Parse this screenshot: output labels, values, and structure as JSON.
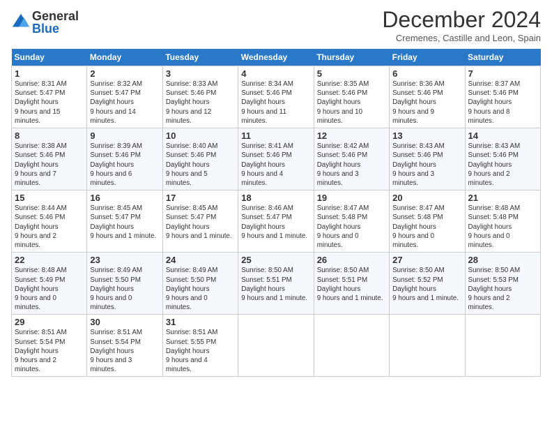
{
  "header": {
    "logo_general": "General",
    "logo_blue": "Blue",
    "month_title": "December 2024",
    "location": "Cremenes, Castille and Leon, Spain"
  },
  "days_of_week": [
    "Sunday",
    "Monday",
    "Tuesday",
    "Wednesday",
    "Thursday",
    "Friday",
    "Saturday"
  ],
  "weeks": [
    [
      {
        "num": "1",
        "sunrise": "8:31 AM",
        "sunset": "5:47 PM",
        "daylight": "9 hours and 15 minutes."
      },
      {
        "num": "2",
        "sunrise": "8:32 AM",
        "sunset": "5:47 PM",
        "daylight": "9 hours and 14 minutes."
      },
      {
        "num": "3",
        "sunrise": "8:33 AM",
        "sunset": "5:46 PM",
        "daylight": "9 hours and 12 minutes."
      },
      {
        "num": "4",
        "sunrise": "8:34 AM",
        "sunset": "5:46 PM",
        "daylight": "9 hours and 11 minutes."
      },
      {
        "num": "5",
        "sunrise": "8:35 AM",
        "sunset": "5:46 PM",
        "daylight": "9 hours and 10 minutes."
      },
      {
        "num": "6",
        "sunrise": "8:36 AM",
        "sunset": "5:46 PM",
        "daylight": "9 hours and 9 minutes."
      },
      {
        "num": "7",
        "sunrise": "8:37 AM",
        "sunset": "5:46 PM",
        "daylight": "9 hours and 8 minutes."
      }
    ],
    [
      {
        "num": "8",
        "sunrise": "8:38 AM",
        "sunset": "5:46 PM",
        "daylight": "9 hours and 7 minutes."
      },
      {
        "num": "9",
        "sunrise": "8:39 AM",
        "sunset": "5:46 PM",
        "daylight": "9 hours and 6 minutes."
      },
      {
        "num": "10",
        "sunrise": "8:40 AM",
        "sunset": "5:46 PM",
        "daylight": "9 hours and 5 minutes."
      },
      {
        "num": "11",
        "sunrise": "8:41 AM",
        "sunset": "5:46 PM",
        "daylight": "9 hours and 4 minutes."
      },
      {
        "num": "12",
        "sunrise": "8:42 AM",
        "sunset": "5:46 PM",
        "daylight": "9 hours and 3 minutes."
      },
      {
        "num": "13",
        "sunrise": "8:43 AM",
        "sunset": "5:46 PM",
        "daylight": "9 hours and 3 minutes."
      },
      {
        "num": "14",
        "sunrise": "8:43 AM",
        "sunset": "5:46 PM",
        "daylight": "9 hours and 2 minutes."
      }
    ],
    [
      {
        "num": "15",
        "sunrise": "8:44 AM",
        "sunset": "5:46 PM",
        "daylight": "9 hours and 2 minutes."
      },
      {
        "num": "16",
        "sunrise": "8:45 AM",
        "sunset": "5:47 PM",
        "daylight": "9 hours and 1 minute."
      },
      {
        "num": "17",
        "sunrise": "8:45 AM",
        "sunset": "5:47 PM",
        "daylight": "9 hours and 1 minute."
      },
      {
        "num": "18",
        "sunrise": "8:46 AM",
        "sunset": "5:47 PM",
        "daylight": "9 hours and 1 minute."
      },
      {
        "num": "19",
        "sunrise": "8:47 AM",
        "sunset": "5:48 PM",
        "daylight": "9 hours and 0 minutes."
      },
      {
        "num": "20",
        "sunrise": "8:47 AM",
        "sunset": "5:48 PM",
        "daylight": "9 hours and 0 minutes."
      },
      {
        "num": "21",
        "sunrise": "8:48 AM",
        "sunset": "5:48 PM",
        "daylight": "9 hours and 0 minutes."
      }
    ],
    [
      {
        "num": "22",
        "sunrise": "8:48 AM",
        "sunset": "5:49 PM",
        "daylight": "9 hours and 0 minutes."
      },
      {
        "num": "23",
        "sunrise": "8:49 AM",
        "sunset": "5:50 PM",
        "daylight": "9 hours and 0 minutes."
      },
      {
        "num": "24",
        "sunrise": "8:49 AM",
        "sunset": "5:50 PM",
        "daylight": "9 hours and 0 minutes."
      },
      {
        "num": "25",
        "sunrise": "8:50 AM",
        "sunset": "5:51 PM",
        "daylight": "9 hours and 1 minute."
      },
      {
        "num": "26",
        "sunrise": "8:50 AM",
        "sunset": "5:51 PM",
        "daylight": "9 hours and 1 minute."
      },
      {
        "num": "27",
        "sunrise": "8:50 AM",
        "sunset": "5:52 PM",
        "daylight": "9 hours and 1 minute."
      },
      {
        "num": "28",
        "sunrise": "8:50 AM",
        "sunset": "5:53 PM",
        "daylight": "9 hours and 2 minutes."
      }
    ],
    [
      {
        "num": "29",
        "sunrise": "8:51 AM",
        "sunset": "5:54 PM",
        "daylight": "9 hours and 2 minutes."
      },
      {
        "num": "30",
        "sunrise": "8:51 AM",
        "sunset": "5:54 PM",
        "daylight": "9 hours and 3 minutes."
      },
      {
        "num": "31",
        "sunrise": "8:51 AM",
        "sunset": "5:55 PM",
        "daylight": "9 hours and 4 minutes."
      },
      null,
      null,
      null,
      null
    ]
  ],
  "labels": {
    "sunrise": "Sunrise:",
    "sunset": "Sunset:",
    "daylight": "Daylight hours"
  }
}
